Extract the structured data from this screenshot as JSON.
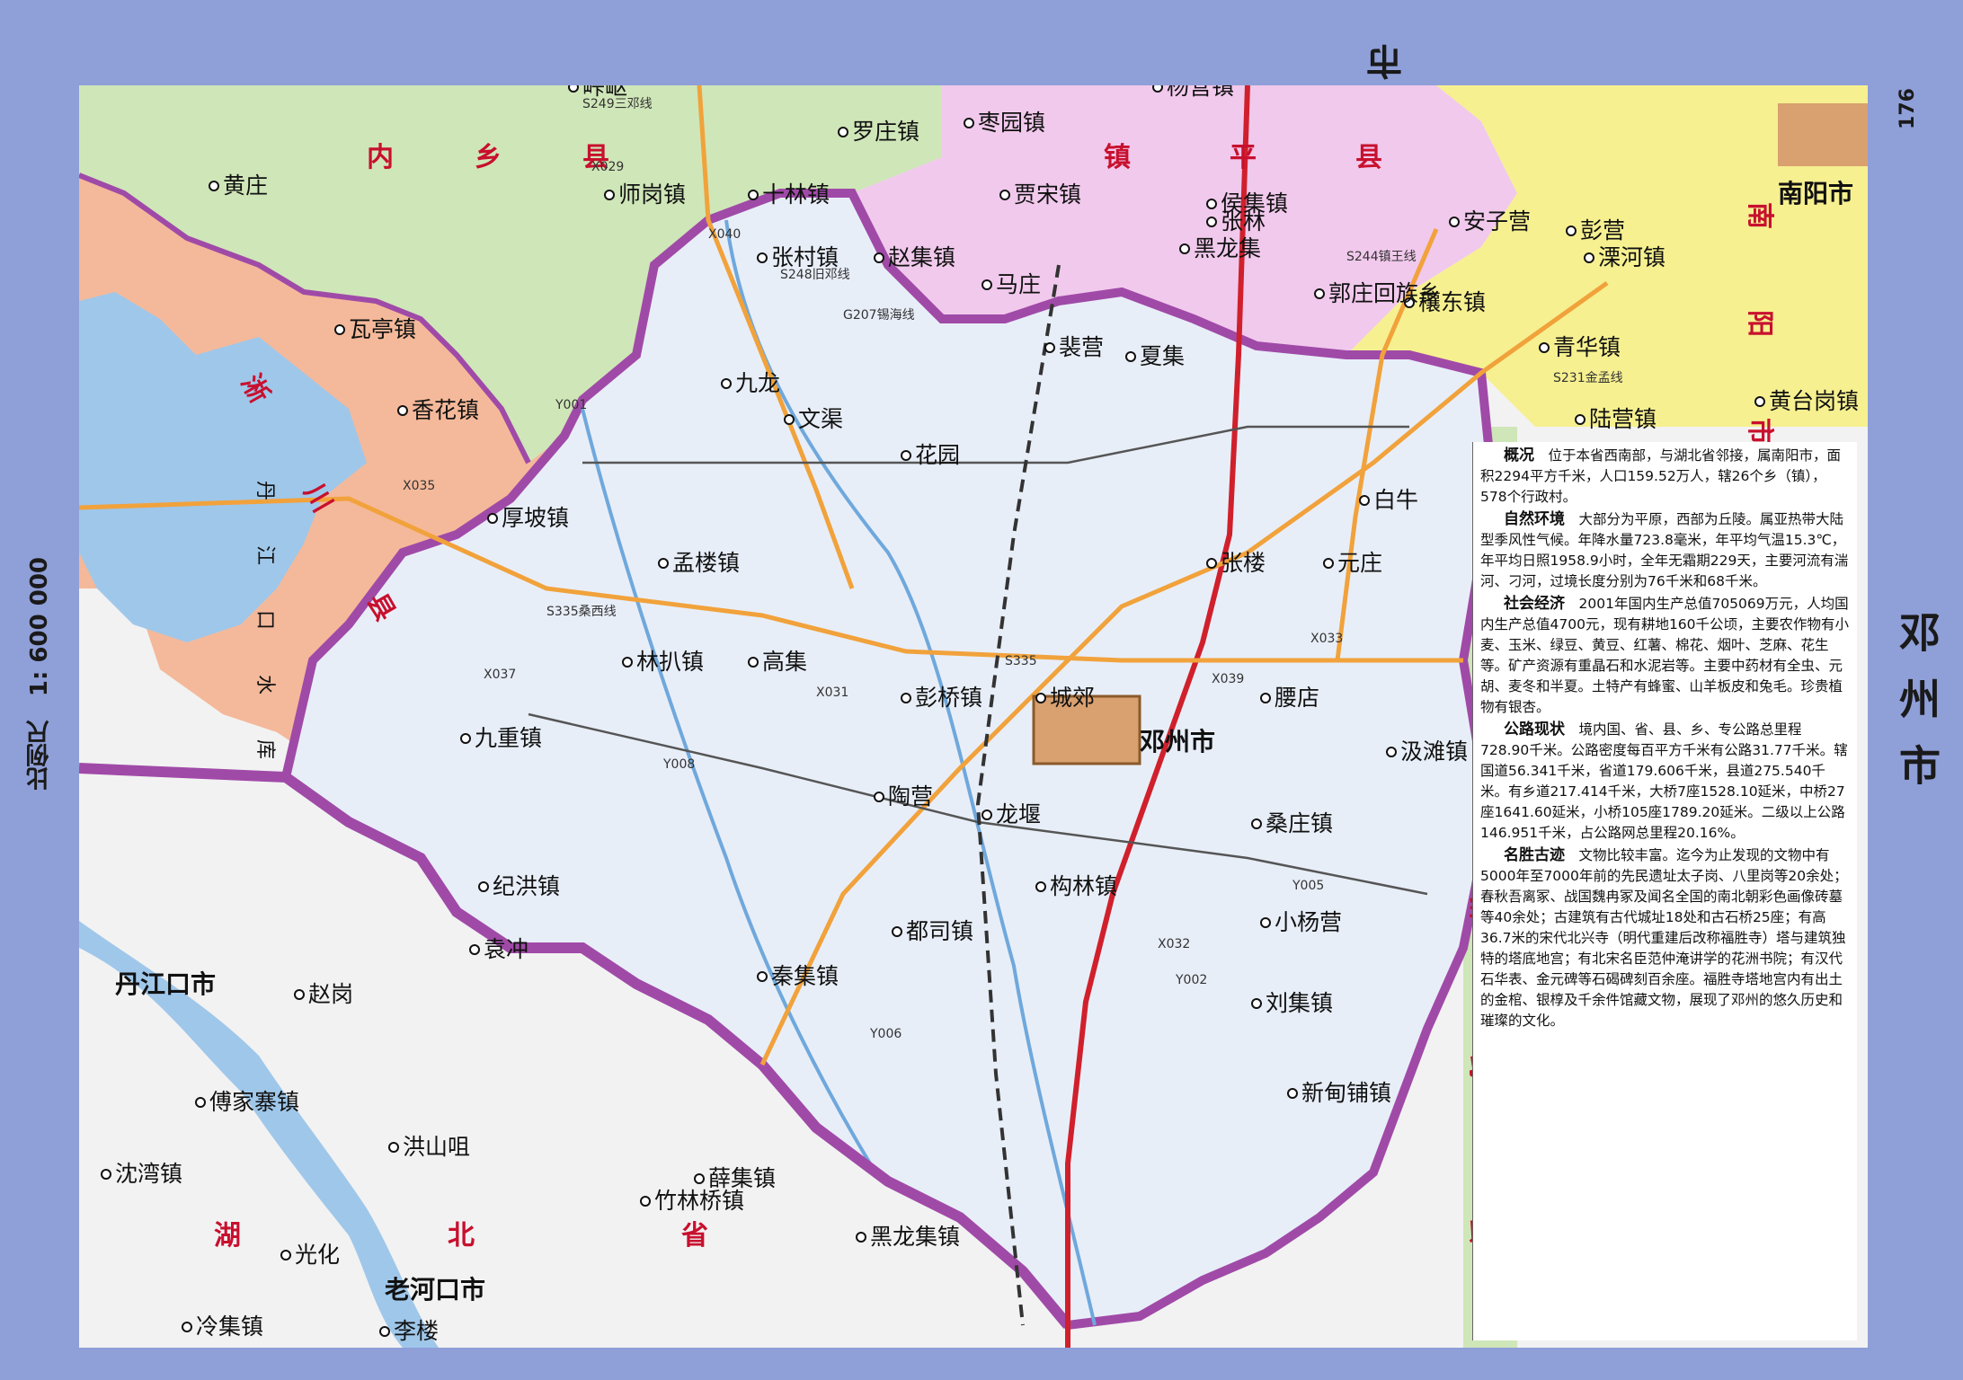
{
  "page": {
    "header_city": "南阳市",
    "page_number": "176",
    "map_title": "邓州市",
    "scale": "比例尺　1: 600 000"
  },
  "colors": {
    "frame": "#8f9fd8",
    "deng_zhou": "#e8eef8",
    "neixiang": "#cfe6b8",
    "xichuan": "#f4b99a",
    "zhenping": "#f1c9ec",
    "nanyang_district": "#f6f090",
    "hubei": "#f2f2f2",
    "water": "#9fc7ea",
    "border": "#a04aa8",
    "national_road": "#d0202c",
    "provincial_road": "#f1a23b",
    "county_road": "#555555"
  },
  "regions": {
    "neixiang": "内　乡　县",
    "xichuan": "淅　川　县",
    "zhenping": "镇　平　县",
    "nanyang": "南　阳　市　区",
    "hubei": "湖　北　省",
    "xinye": "新　野　县",
    "reservoir": "丹　江　口　水　库"
  },
  "cities": {
    "dengzhou": "邓州市",
    "nanyang": "南阳市",
    "danjiangkou": "丹江口市",
    "laohekou": "老河口市"
  },
  "towns": {
    "deng": [
      "罗庄镇",
      "十林镇",
      "张村镇",
      "赵集镇",
      "九龙",
      "文渠",
      "孟楼镇",
      "林扒镇",
      "彭桥镇",
      "高集",
      "陶营",
      "龙堰",
      "城郊",
      "构林镇",
      "都司镇",
      "秦集镇",
      "刘集镇",
      "桑庄镇",
      "小杨营",
      "汲滩镇",
      "腰店",
      "张楼",
      "元庄",
      "白牛",
      "穰东镇",
      "黑龙集",
      "夏集",
      "裴营",
      "花园",
      "新甸铺镇",
      "九重镇"
    ],
    "outside": [
      "师岗镇",
      "瓦亭镇",
      "香花镇",
      "厚坡镇",
      "杨营镇",
      "侯集镇",
      "张林",
      "贾宋镇",
      "枣园镇",
      "马庄",
      "郭庄回族乡",
      "安子营",
      "彭营",
      "溧河镇",
      "青华镇",
      "陆营镇",
      "黄台岗镇",
      "纪洪镇",
      "袁冲",
      "傅家寨镇",
      "沈湾镇",
      "光化",
      "冷集镇",
      "竹林桥镇",
      "薛集镇",
      "黑龙集镇",
      "李楼",
      "洪山咀",
      "赵岗",
      "峠岖",
      "黄庄"
    ]
  },
  "roads": [
    "S249三邓线",
    "S248旧邓线",
    "G207锡海线",
    "S244镇王线",
    "S231金孟线",
    "S335桑西线",
    "S335",
    "X029",
    "X040",
    "X035",
    "X037",
    "X031",
    "X032",
    "X033",
    "X039",
    "Y001",
    "Y002",
    "Y005",
    "Y006",
    "Y008"
  ],
  "info": {
    "overview_title": "概况",
    "overview": "位于本省西南部，与湖北省邻接，属南阳市，面积2294平方千米，人口159.52万人，辖26个乡（镇），578个行政村。",
    "nature_title": "自然环境",
    "nature": "大部分为平原，西部为丘陵。属亚热带大陆型季风性气候。年降水量723.8毫米，年平均气温15.3℃，年平均日照1958.9小时，全年无霜期229天，主要河流有湍河、刁河，过境长度分别为76千米和68千米。",
    "economy_title": "社会经济",
    "economy": "2001年国内生产总值705069万元，人均国内生产总值4700元，现有耕地160千公顷，主要农作物有小麦、玉米、绿豆、黄豆、红薯、棉花、烟叶、芝麻、花生等。矿产资源有重晶石和水泥岩等。主要中药材有全虫、元胡、麦冬和半夏。土特产有蜂蜜、山羊板皮和兔毛。珍贵植物有银杏。",
    "roads_title": "公路现状",
    "roads": "境内国、省、县、乡、专公路总里程728.90千米。公路密度每百平方千米有公路31.77千米。辖国道56.341千米，省道179.606千米，县道275.540千米。有乡道217.414千米，大桥7座1528.10延米，中桥27座1641.60延米，小桥105座1789.20延米。二级以上公路146.951千米，占公路网总里程20.16%。",
    "sights_title": "名胜古迹",
    "sights": "文物比较丰富。迄今为止发现的文物中有5000年至7000年前的先民遗址太子岗、八里岗等20余处；春秋吾离冢、战国魏冉冢及闻名全国的南北朝彩色画像砖墓等40余处；古建筑有古代城址18处和古石桥25座；有高36.7米的宋代北兴寺（明代重建后改称福胜寺）塔与建筑独特的塔底地宫；有北宋名臣范仲淹讲学的花洲书院；有汉代石华表、金元碑等石碣碑刻百余座。福胜寺塔地宫内有出土的金棺、银椁及千余件馆藏文物，展现了邓州的悠久历史和璀璨的文化。"
  }
}
